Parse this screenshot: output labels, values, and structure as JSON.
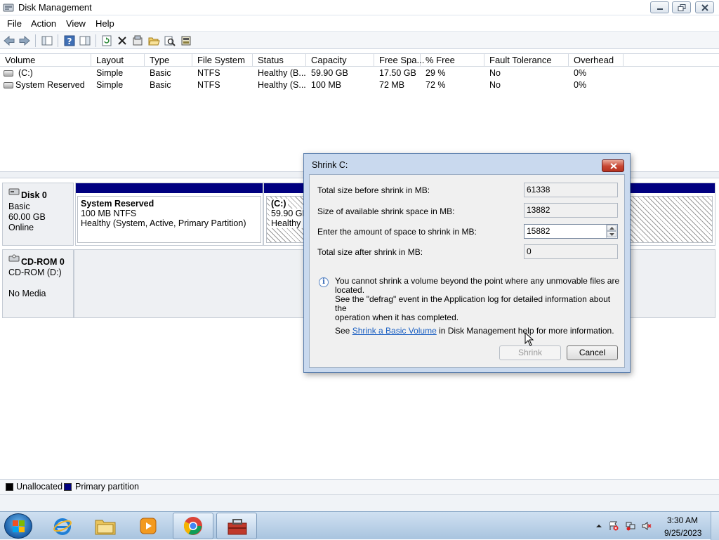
{
  "window": {
    "title": "Disk Management"
  },
  "menu": [
    "File",
    "Action",
    "View",
    "Help"
  ],
  "volume_list": {
    "columns": [
      "Volume",
      "Layout",
      "Type",
      "File System",
      "Status",
      "Capacity",
      "Free Spa...",
      "% Free",
      "Fault Tolerance",
      "Overhead"
    ],
    "rows": [
      [
        "(C:)",
        "Simple",
        "Basic",
        "NTFS",
        "Healthy (B...",
        "59.90 GB",
        "17.50 GB",
        "29 %",
        "No",
        "0%"
      ],
      [
        "System Reserved",
        "Simple",
        "Basic",
        "NTFS",
        "Healthy (S...",
        "100 MB",
        "72 MB",
        "72 %",
        "No",
        "0%"
      ]
    ]
  },
  "disks": [
    {
      "name": "Disk 0",
      "type": "Basic",
      "size": "60.00 GB",
      "state": "Online",
      "partitions": [
        {
          "name": "System Reserved",
          "detail": "100 MB NTFS",
          "status": "Healthy (System, Active, Primary Partition)"
        },
        {
          "name": "(C:)",
          "detail": "59.90 GB",
          "status": "Healthy ("
        }
      ]
    },
    {
      "name": "CD-ROM 0",
      "type": "CD-ROM (D:)",
      "state": "No Media"
    }
  ],
  "legend": [
    {
      "label": "Unallocated",
      "color": "#000000"
    },
    {
      "label": "Primary partition",
      "color": "#000080"
    }
  ],
  "dialog": {
    "title": "Shrink C:",
    "fields": [
      {
        "label": "Total size before shrink in MB:",
        "value": "61338"
      },
      {
        "label": "Size of available shrink space in MB:",
        "value": "13882"
      },
      {
        "label": "Enter the amount of space to shrink in MB:",
        "value": "15882"
      },
      {
        "label": "Total size after shrink in MB:",
        "value": "0"
      }
    ],
    "info_lines": [
      "You cannot shrink a volume beyond the point where any unmovable files are located.",
      "See the \"defrag\" event in the Application log for detailed information about the",
      "operation when it has completed."
    ],
    "help_prefix": "See ",
    "help_link": "Shrink a Basic Volume",
    "help_suffix": " in Disk Management help for more information.",
    "shrink_label": "Shrink",
    "cancel_label": "Cancel"
  },
  "taskbar": {
    "time": "3:30 AM",
    "date": "9/25/2023"
  },
  "icons": {
    "app": "disk-management-icon",
    "close": "close-icon",
    "info": "info-icon",
    "start": "windows-start-icon",
    "ie": "internet-explorer-icon",
    "explorer": "folder-icon",
    "media": "media-player-icon",
    "chrome": "chrome-icon",
    "computer_mgmt": "toolbox-icon"
  }
}
